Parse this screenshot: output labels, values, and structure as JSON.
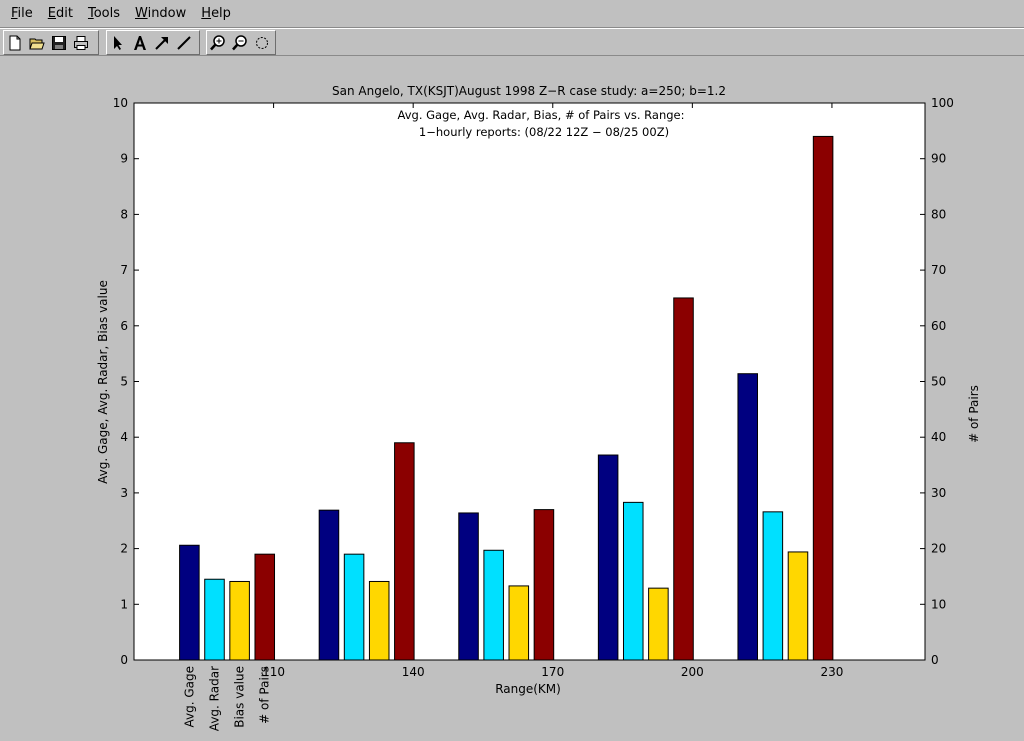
{
  "window": {
    "menus": [
      "File",
      "Edit",
      "Tools",
      "Window",
      "Help"
    ],
    "toolbar_icons": [
      "new-file-icon",
      "open-folder-icon",
      "save-icon",
      "print-icon",
      "pointer-arrow-icon",
      "text-tool-icon",
      "arrow-tool-icon",
      "line-tool-icon",
      "zoom-in-icon",
      "zoom-out-icon",
      "rotate-icon"
    ]
  },
  "chart_data": {
    "type": "bar",
    "title": "San Angelo, TX(KSJT)August 1998 Z−R case study: a=250; b=1.2",
    "subtitle": [
      "Avg. Gage, Avg. Radar, Bias, # of Pairs vs. Range:",
      "1−hourly reports: (08/22 12Z − 08/25 00Z)"
    ],
    "xlabel": "Range(KM)",
    "ylabel": "Avg. Gage, Avg. Radar, Bias value",
    "ylabel_right": "# of Pairs",
    "xlim": [
      80,
      250
    ],
    "xticks": [
      110,
      140,
      170,
      200,
      230
    ],
    "ylim": [
      0,
      10
    ],
    "yticks": [
      0,
      1,
      2,
      3,
      4,
      5,
      6,
      7,
      8,
      9,
      10
    ],
    "ylim_right": [
      0,
      100
    ],
    "yticks_right": [
      0,
      10,
      20,
      30,
      40,
      50,
      60,
      70,
      80,
      90,
      100
    ],
    "group_centers": [
      100,
      130,
      160,
      190,
      220
    ],
    "bar_width_data": 4.2,
    "bar_offsets": [
      -8.1,
      -2.7,
      2.7,
      8.1
    ],
    "series": [
      {
        "name": "Avg. Gage",
        "axis": "left",
        "color": "#000080",
        "values": [
          2.06,
          2.69,
          2.64,
          3.68,
          5.14
        ]
      },
      {
        "name": "Avg. Radar",
        "axis": "left",
        "color": "#00e0ff",
        "values": [
          1.45,
          1.9,
          1.97,
          2.83,
          2.66
        ]
      },
      {
        "name": "Bias value",
        "axis": "left",
        "color": "#ffd700",
        "values": [
          1.41,
          1.41,
          1.33,
          1.29,
          1.94
        ]
      },
      {
        "name": "# of Pairs",
        "axis": "right",
        "color": "#8b0000",
        "values": [
          19,
          39,
          27,
          65,
          94
        ]
      }
    ],
    "legend_placement": "below-x-axis-rotated",
    "grid": false
  }
}
